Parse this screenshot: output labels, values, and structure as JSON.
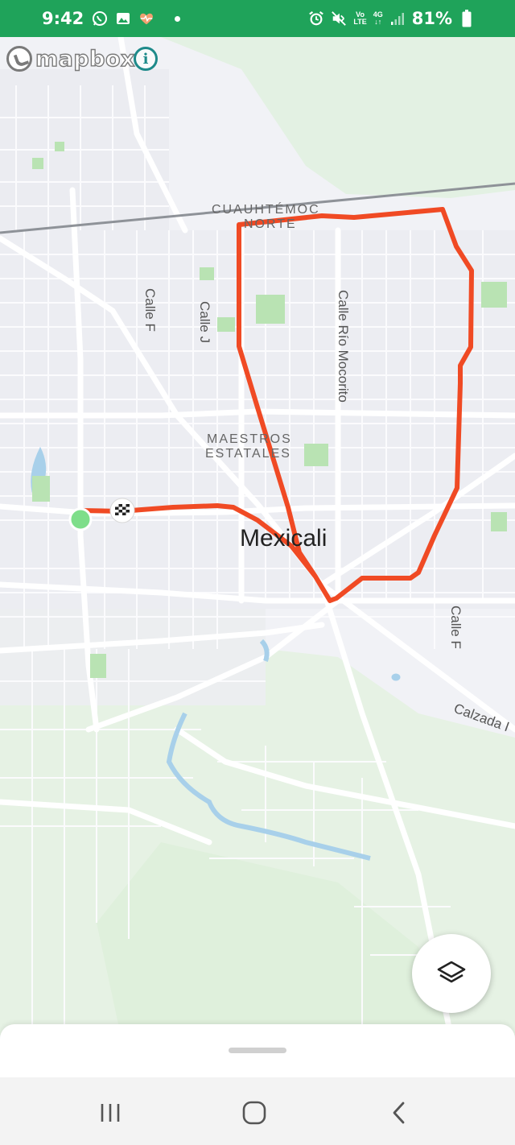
{
  "status_bar": {
    "time": "9:42",
    "left_icons": [
      "whatsapp-icon",
      "gallery-icon",
      "health-icon",
      "notification-dot"
    ],
    "right_icons": [
      "alarm-icon",
      "mute-icon",
      "volte-icon",
      "4g-icon",
      "signal-icon"
    ],
    "volte_line1": "Vo",
    "volte_line2": "LTE",
    "network_type": "4G",
    "battery_percent": "81%",
    "background_color": "#1fa35a"
  },
  "map": {
    "attribution": "mapbox",
    "info_icon": "info-icon",
    "info_label": "i",
    "city": "Mexicali",
    "neighborhoods": [
      {
        "line1": "CUAUHTÉMOC",
        "line2": "NORTE"
      },
      {
        "line1": "MAESTROS",
        "line2": "ESTATALES"
      }
    ],
    "streets": {
      "calle_f_west": "Calle F",
      "calle_j": "Calle J",
      "calle_rio_mocorito": "Calle Río Mocorito",
      "calle_f_east": "Calle F",
      "calzada": "Calzada I"
    },
    "route_color": "#f04a24",
    "start_marker_color": "#7ede8a",
    "finish_marker": "checkered-flag-icon",
    "layers_button": "layers-icon"
  },
  "bottom_sheet": {
    "handle": "drag-handle"
  },
  "nav_bar": {
    "recents": "recents-icon",
    "home": "home-icon",
    "back": "back-icon"
  }
}
